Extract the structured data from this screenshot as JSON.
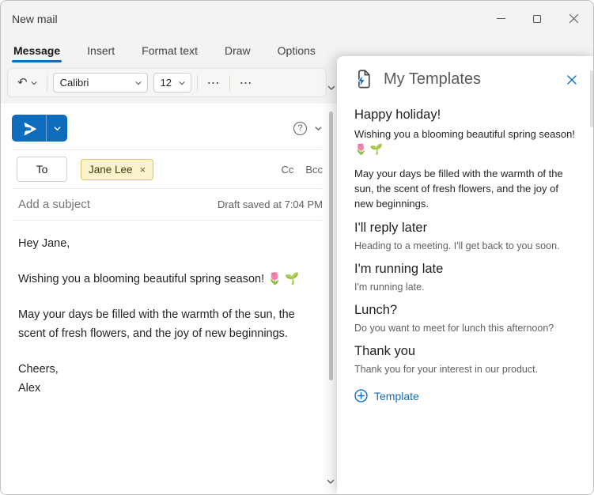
{
  "window": {
    "title": "New mail"
  },
  "ribbon": {
    "tabs": [
      "Message",
      "Insert",
      "Format text",
      "Draw",
      "Options"
    ],
    "font_name": "Calibri",
    "font_size": "12"
  },
  "icons": {
    "undo": "↶",
    "more": "⋯",
    "help": "?",
    "chip_dismiss": "×"
  },
  "compose": {
    "to_label": "To",
    "recipient_chip": "Jane Lee",
    "cc_label": "Cc",
    "bcc_label": "Bcc",
    "subject_placeholder": "Add a subject",
    "draft_status": "Draft saved at 7:04 PM",
    "body_paragraphs": [
      "Hey Jane,",
      "Wishing you a blooming beautiful spring season! 🌷 🌱",
      "May your days be filled with the warmth of the sun, the scent of fresh flowers, and the joy of new beginnings.",
      "Cheers,\nAlex"
    ]
  },
  "panel": {
    "title": "My Templates",
    "items": [
      {
        "title": "Happy holiday!",
        "body": "Wishing you a blooming beautiful spring season! 🌷 🌱",
        "body2": "May your days be filled with the warmth of the sun, the scent of fresh flowers, and the joy of new beginnings."
      },
      {
        "title": "I'll reply later",
        "body": "Heading to a meeting. I'll get back to you soon."
      },
      {
        "title": "I'm running late",
        "body": "I'm running late."
      },
      {
        "title": "Lunch?",
        "body": "Do you want to meet for lunch this afternoon?"
      },
      {
        "title": "Thank you",
        "body": "Thank you for your interest in our product."
      }
    ],
    "add_button_label": "Template"
  },
  "colors": {
    "accent": "#0f6cbd",
    "chip_bg": "#fcf3cc",
    "chip_border": "#d9c567"
  }
}
